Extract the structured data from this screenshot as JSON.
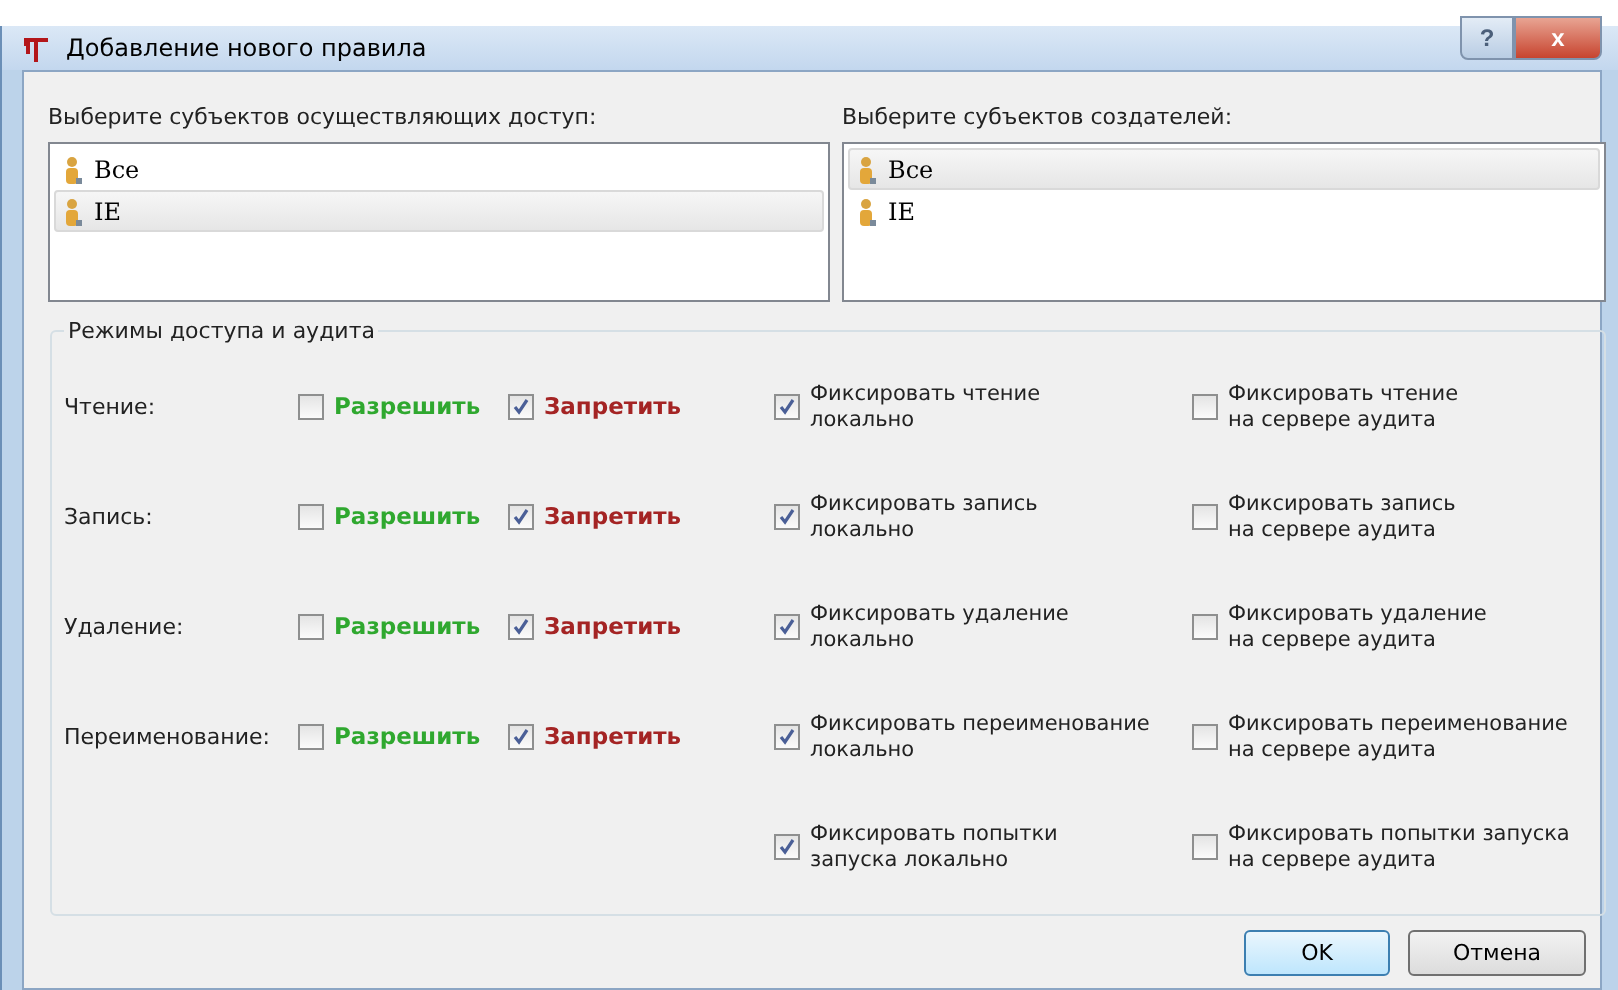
{
  "window": {
    "title": "Добавление нового правила",
    "buttons": [
      {
        "kind": "help",
        "label": "?"
      },
      {
        "kind": "close",
        "label": "x"
      }
    ]
  },
  "lists": [
    {
      "label": "Выберите субъектов осуществляющих доступ:",
      "items": [
        {
          "label": "Все",
          "selected": false
        },
        {
          "label": "IE",
          "selected": true
        }
      ]
    },
    {
      "label": "Выберите субъектов создателей:",
      "items": [
        {
          "label": "Все",
          "selected": true
        },
        {
          "label": "IE",
          "selected": false
        }
      ]
    }
  ],
  "group": {
    "title": "Режимы доступа и аудита",
    "rows": [
      {
        "label": "Чтение:",
        "options": [
          {
            "kind": "allow",
            "label": "Разрешить",
            "checked": false
          },
          {
            "kind": "deny",
            "label": "Запретить",
            "checked": true
          },
          {
            "kind": "local",
            "label": "Фиксировать чтение\nлокально",
            "checked": true
          },
          {
            "kind": "server",
            "label": "Фиксировать чтение\nна сервере аудита",
            "checked": false
          }
        ]
      },
      {
        "label": "Запись:",
        "options": [
          {
            "kind": "allow",
            "label": "Разрешить",
            "checked": false
          },
          {
            "kind": "deny",
            "label": "Запретить",
            "checked": true
          },
          {
            "kind": "local",
            "label": "Фиксировать запись\nлокально",
            "checked": true
          },
          {
            "kind": "server",
            "label": "Фиксировать запись\nна сервере аудита",
            "checked": false
          }
        ]
      },
      {
        "label": "Удаление:",
        "options": [
          {
            "kind": "allow",
            "label": "Разрешить",
            "checked": false
          },
          {
            "kind": "deny",
            "label": "Запретить",
            "checked": true
          },
          {
            "kind": "local",
            "label": "Фиксировать удаление\nлокально",
            "checked": true
          },
          {
            "kind": "server",
            "label": "Фиксировать удаление\nна сервере аудита",
            "checked": false
          }
        ]
      },
      {
        "label": "Переименование:",
        "options": [
          {
            "kind": "allow",
            "label": "Разрешить",
            "checked": false
          },
          {
            "kind": "deny",
            "label": "Запретить",
            "checked": true
          },
          {
            "kind": "local",
            "label": "Фиксировать переименование\nлокально",
            "checked": true
          },
          {
            "kind": "server",
            "label": "Фиксировать переименование\nна сервере аудита",
            "checked": false
          }
        ]
      },
      {
        "options": [
          {
            "kind": "local",
            "label": "Фиксировать попытки\nзапуска локально",
            "checked": true
          },
          {
            "kind": "server",
            "label": "Фиксировать попытки запуска\nна сервере аудита",
            "checked": false
          }
        ]
      }
    ]
  },
  "buttons": [
    {
      "label": "OK",
      "default": true
    },
    {
      "label": "Отмена",
      "default": false
    }
  ]
}
